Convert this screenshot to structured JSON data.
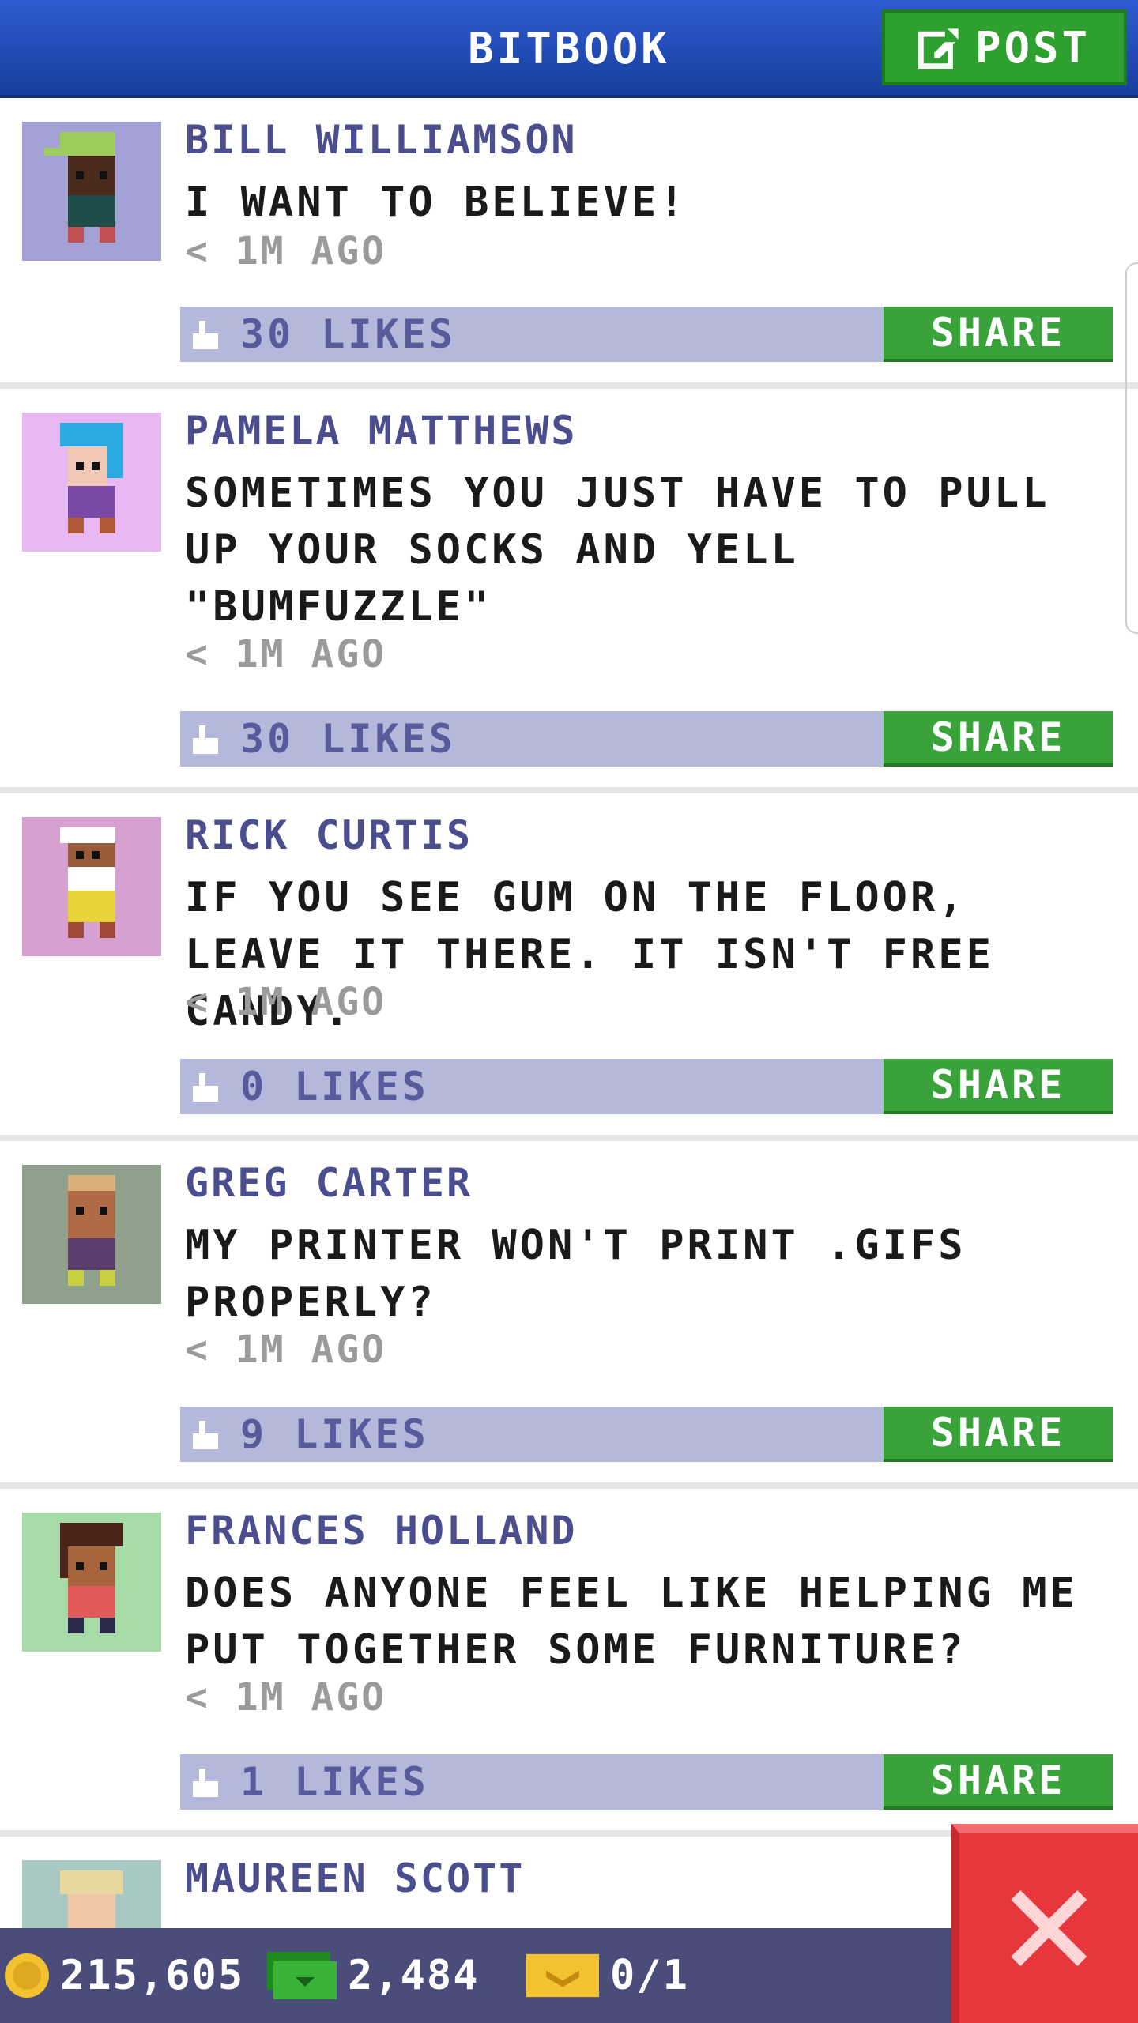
{
  "header": {
    "title": "BITBOOK",
    "post_label": "POST"
  },
  "posts": [
    {
      "name": "BILL WILLIAMSON",
      "message": "I WANT TO BELIEVE!",
      "time": "< 1M AGO",
      "likes": "30 LIKES",
      "share_label": "SHARE",
      "avatar_bg": "#a3a0d6"
    },
    {
      "name": "PAMELA MATTHEWS",
      "message": "SOMETIMES YOU JUST HAVE TO PULL UP YOUR SOCKS AND YELL \"BUMFUZZLE\"",
      "time": "< 1M AGO",
      "likes": "30 LIKES",
      "share_label": "SHARE",
      "avatar_bg": "#e8b8f3"
    },
    {
      "name": "RICK CURTIS",
      "message": "IF YOU SEE GUM ON THE FLOOR, LEAVE IT THERE. IT ISN'T FREE CANDY.",
      "time": "< 1M AGO",
      "likes": "0 LIKES",
      "share_label": "SHARE",
      "avatar_bg": "#d6a0d0"
    },
    {
      "name": "GREG CARTER",
      "message": "MY PRINTER WON'T PRINT .GIFS PROPERLY?",
      "time": "< 1M AGO",
      "likes": "9 LIKES",
      "share_label": "SHARE",
      "avatar_bg": "#8fa08c"
    },
    {
      "name": "FRANCES HOLLAND",
      "message": "DOES ANYONE FEEL LIKE HELPING ME PUT TOGETHER SOME FURNITURE?",
      "time": "< 1M AGO",
      "likes": "1 LIKES",
      "share_label": "SHARE",
      "avatar_bg": "#a6dba8"
    },
    {
      "name": "MAUREEN SCOTT",
      "avatar_bg": "#a8c8c4"
    }
  ],
  "status_bar": {
    "coins": "215,605",
    "bux": "2,484",
    "tickets": "0/1"
  },
  "colors": {
    "header": "#2f5bd0",
    "accent_green": "#3aa23a",
    "like_bar": "#b4b8da",
    "name_color": "#4b4e8e",
    "close_red": "#e8373c"
  },
  "icons": {
    "post": "edit-icon",
    "like": "thumbs-up-icon",
    "coin": "coin-icon",
    "bux": "bux-icon",
    "ticket": "ticket-icon",
    "close": "close-icon"
  }
}
